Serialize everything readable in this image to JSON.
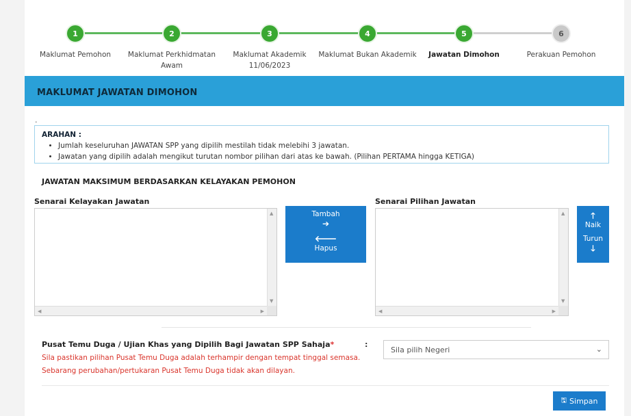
{
  "stepper": {
    "steps": [
      {
        "number": "1",
        "label": "Maklumat Pemohon",
        "sub": ""
      },
      {
        "number": "2",
        "label": "Maklumat Perkhidmatan",
        "sub": "Awam"
      },
      {
        "number": "3",
        "label": "Maklumat Akademik",
        "sub": "11/06/2023"
      },
      {
        "number": "4",
        "label": "Maklumat Bukan Akademik",
        "sub": ""
      },
      {
        "number": "5",
        "label": "Jawatan Dimohon",
        "sub": ""
      },
      {
        "number": "6",
        "label": "Perakuan Pemohon",
        "sub": ""
      }
    ],
    "active_step": 5,
    "completed_color": "#3aa832",
    "pending_color": "#c9c9c9"
  },
  "section": {
    "title": "MAKLUMAT JAWATAN DIMOHON",
    "header_color": "#2aa0d8",
    "dot": "."
  },
  "arahan": {
    "title": "ARAHAN :",
    "items": [
      "Jumlah keseluruhan JAWATAN SPP yang dipilih mestilah tidak melebihi 3 jawatan.",
      "Jawatan yang dipilih adalah mengikut turutan nombor pilihan dari atas ke bawah. (Pilihan PERTAMA hingga KETIGA)"
    ]
  },
  "max_heading": "JAWATAN MAKSIMUM BERDASARKAN KELAYAKAN PEMOHON",
  "lists": {
    "eligible_title": "Senarai Kelayakan Jawatan",
    "chosen_title": "Senarai Pilihan Jawatan"
  },
  "buttons": {
    "add": "Tambah",
    "remove": "Hapus",
    "up": "Naik",
    "down": "Turun",
    "save": "Simpan",
    "accent": "#1b7ccb"
  },
  "interview": {
    "label": "Pusat Temu Duga / Ujian Khas yang Dipilih Bagi Jawatan SPP Sahaja",
    "required_mark": "*",
    "note_line1": "Sila pastikan pilihan Pusat Temu Duga adalah terhampir dengan tempat tinggal semasa.",
    "note_line2": "Sebarang perubahan/pertukaran Pusat Temu Duga tidak akan dilayan.",
    "colon": ":",
    "select_value": "Sila pilih Negeri"
  }
}
